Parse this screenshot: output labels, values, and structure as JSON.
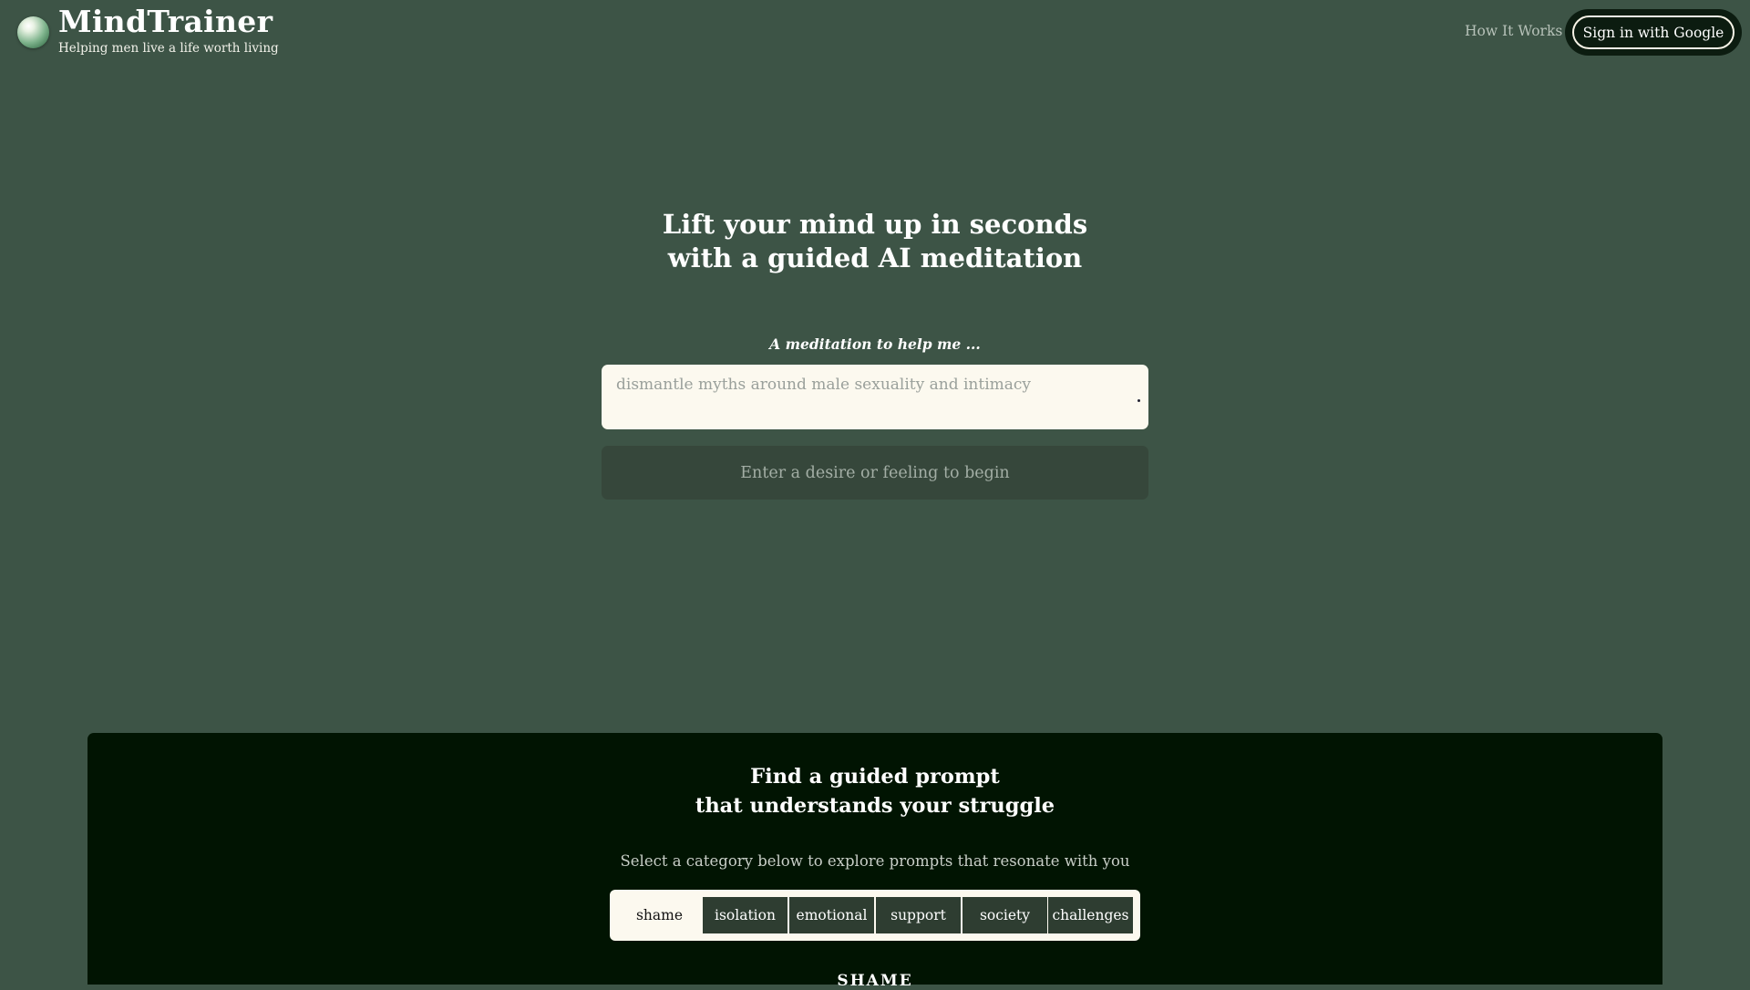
{
  "brand": {
    "name": "MindTrainer",
    "tagline": "Helping men live a life worth living"
  },
  "nav": {
    "how_it_works": "How It Works",
    "sign_in": "Sign in with Google"
  },
  "hero": {
    "title_line1": "Lift your mind up in seconds",
    "title_line2": "with a guided AI meditation",
    "prompt_label": "A meditation to help me ...",
    "prompt_placeholder": "dismantle myths around male sexuality and intimacy",
    "prompt_value": "",
    "begin_button": "Enter a desire or feeling to begin"
  },
  "prompts_section": {
    "title_line1": "Find a guided prompt",
    "title_line2": "that understands your struggle",
    "subtitle": "Select a category below to explore prompts that resonate with you",
    "categories": [
      "shame",
      "isolation",
      "emotional",
      "support",
      "society",
      "challenges"
    ],
    "selected_category": "shame",
    "section_heading": "SHAME"
  },
  "colors": {
    "page_background": "#3d5446",
    "dark_panel": "#011402",
    "input_background": "#fcf9ef",
    "category_button": "#2e3d31"
  }
}
